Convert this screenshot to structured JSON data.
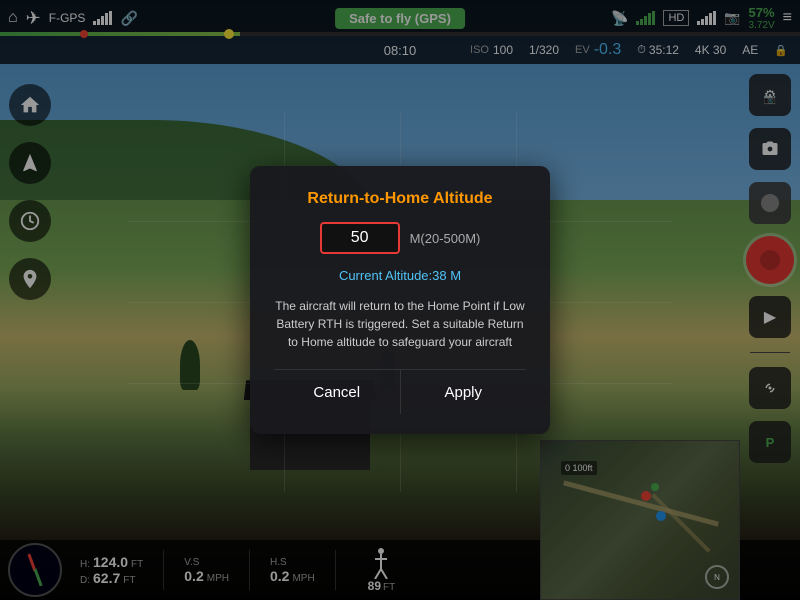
{
  "topbar": {
    "home_icon": "⌂",
    "drone_icon": "✦",
    "gps_label": "F-GPS",
    "signal_icon": "📶",
    "status_label": "Safe to fly (GPS)",
    "remote_icon": "🎮",
    "hd_label": "HD",
    "camera_icon": "📷",
    "battery_percent": "57%",
    "battery_voltage": "3.72V",
    "menu_icon": "≡"
  },
  "subbar": {
    "time": "08:10",
    "iso_label": "ISO",
    "iso_value": "100",
    "shutter": "1/320",
    "ev_label": "EV",
    "ev_value": "-0.3",
    "timer": "35:12",
    "res": "4K 30",
    "ae_label": "AE",
    "lock_icon": "🔒"
  },
  "dialog": {
    "title": "Return-to-Home Altitude",
    "altitude_value": "50",
    "altitude_range": "M(20-500M)",
    "current_altitude_label": "Current Altitude:38 M",
    "description": "The aircraft will return to the Home Point if Low Battery RTH is triggered. Set a suitable Return to Home altitude to safeguard your aircraft",
    "cancel_label": "Cancel",
    "apply_label": "Apply"
  },
  "bottom": {
    "h_label": "H:",
    "h_value": "124.0",
    "h_unit": "FT",
    "d_label": "D:",
    "d_value": "62.7",
    "d_unit": "FT",
    "vs_label": "V.S",
    "vs_value": "0.2",
    "vs_unit": "MPH",
    "hs_label": "H.S",
    "hs_value": "0.2",
    "hs_unit": "MPH",
    "person_height": "89",
    "person_unit": "FT"
  },
  "sidebar_right": {
    "camera_settings_icon": "⚙",
    "photo_icon": "📷",
    "switch_icon": "⬤",
    "video_icon": "📹",
    "play_icon": "▶",
    "settings_icon": "⚙",
    "parking_icon": "P"
  }
}
